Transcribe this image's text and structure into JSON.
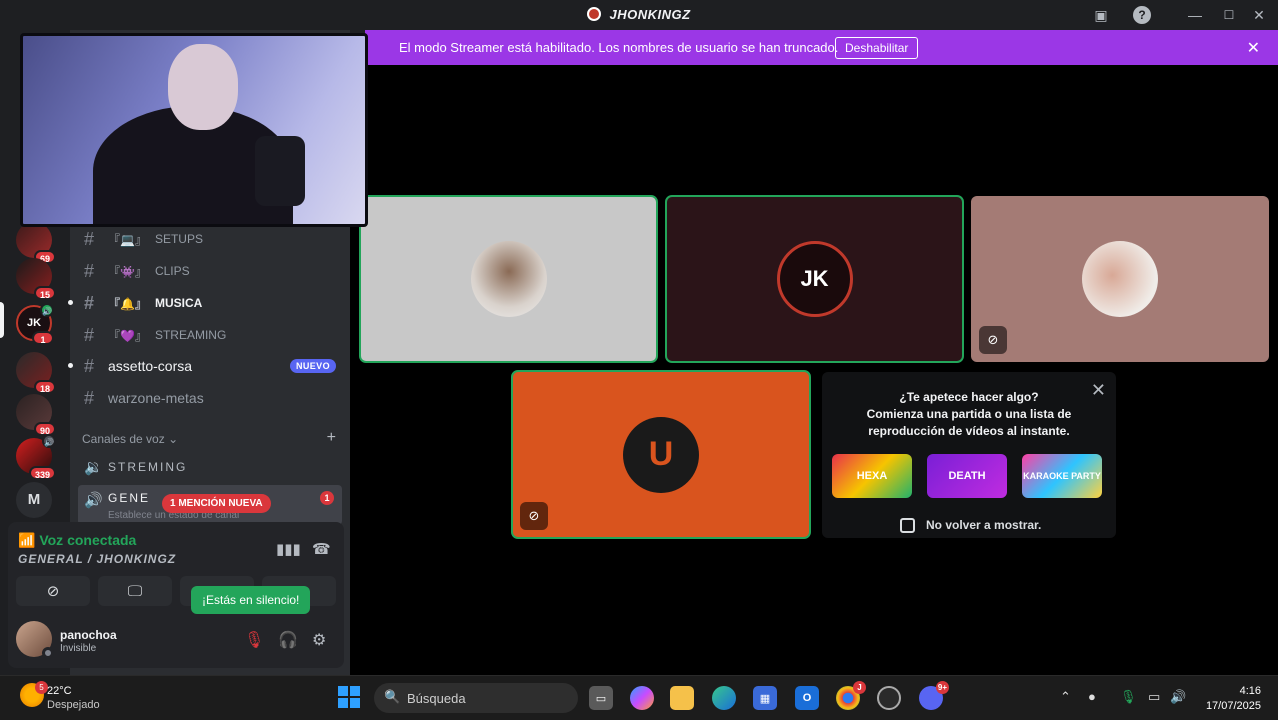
{
  "window": {
    "title": "JHONKINGZ"
  },
  "rail": {
    "servers": [
      {
        "label": "",
        "badge": "69"
      },
      {
        "label": "",
        "badge": "15"
      },
      {
        "label": "JK",
        "badge": "1"
      },
      {
        "label": "",
        "badge": "18"
      },
      {
        "label": "",
        "badge": "90"
      },
      {
        "label": "",
        "badge": "339"
      },
      {
        "label": "M",
        "badge": ""
      }
    ]
  },
  "channels": {
    "text": [
      {
        "emoji": "『💻』",
        "name": "SETUPS"
      },
      {
        "emoji": "『👾』",
        "name": "CLIPS"
      },
      {
        "emoji": "『🔔』",
        "name": "MUSICA"
      },
      {
        "emoji": "『💜』",
        "name": "STREAMING"
      },
      {
        "emoji": "",
        "name": "assetto-corsa",
        "tag": "NUEVO"
      },
      {
        "emoji": "",
        "name": "warzone-metas"
      }
    ],
    "voice_header": "Canales de voz",
    "voice": [
      {
        "name": "STREMING"
      },
      {
        "name": "GENE",
        "sub": "Establece un estado de canal",
        "mention": "1 MENCIÓN NUEVA",
        "count": "1"
      }
    ]
  },
  "voice_panel": {
    "status": "Voz conectada",
    "location": "GENERAL / JHONKINGZ",
    "tooltip": "¡Estás en silencio!"
  },
  "user": {
    "name": "panochoa",
    "status": "Invisible"
  },
  "streamer_banner": {
    "message": "El modo Streamer está habilitado. Los nombres de usuario se han truncado.",
    "button": "Deshabilitar"
  },
  "activity": {
    "title": "¿Te apetece hacer algo?",
    "subtitle": "Comienza una partida o una lista de reproducción de vídeos al instante.",
    "games": [
      "HEXA",
      "DEATH",
      "KARAOKE PARTY"
    ],
    "checkbox_label": "No volver a mostrar."
  },
  "taskbar": {
    "weather_temp": "22°C",
    "weather_desc": "Despejado",
    "weather_badge": "5",
    "search": "Búsqueda",
    "chrome_badge": "J",
    "discord_badge": "9+",
    "time": "4:16",
    "date": "17/07/2025"
  },
  "colors": {
    "accent_green": "#23a55a",
    "streamer_purple": "#9b37e6",
    "badge_red": "#da373c",
    "tile_orange": "#d9541e"
  }
}
